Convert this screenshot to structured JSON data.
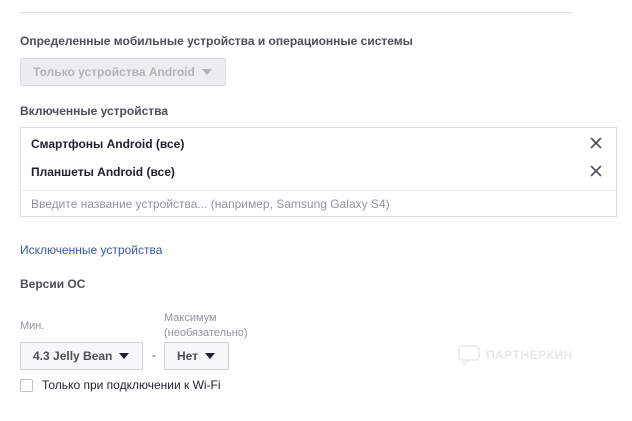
{
  "platforms": {
    "heading": "Определенные мобильные устройства и операционные системы",
    "selected": "Только устройства Android"
  },
  "included_devices": {
    "heading": "Включенные устройства",
    "items": [
      {
        "label": "Смартфоны Android (все)"
      },
      {
        "label": "Планшеты Android (все)"
      }
    ],
    "placeholder": "Введите название устройства... (например, Samsung Galaxy S4)"
  },
  "excluded_devices": {
    "link": "Исключенные устройства"
  },
  "os_versions": {
    "heading": "Версии ОС",
    "min_label": "Мин.",
    "max_label_line1": "Максимум",
    "max_label_line2": "(необязательно)",
    "min_value": "4.3 Jelly Bean",
    "separator": "-",
    "max_value": "Нет"
  },
  "wifi": {
    "label": "Только при подключении к Wi-Fi",
    "checked": false
  },
  "watermark": {
    "text": "ПАРТНЕРКИН"
  },
  "colors": {
    "link": "#365899",
    "border": "#dddfe2",
    "disabled_bg": "#ebedf0"
  }
}
